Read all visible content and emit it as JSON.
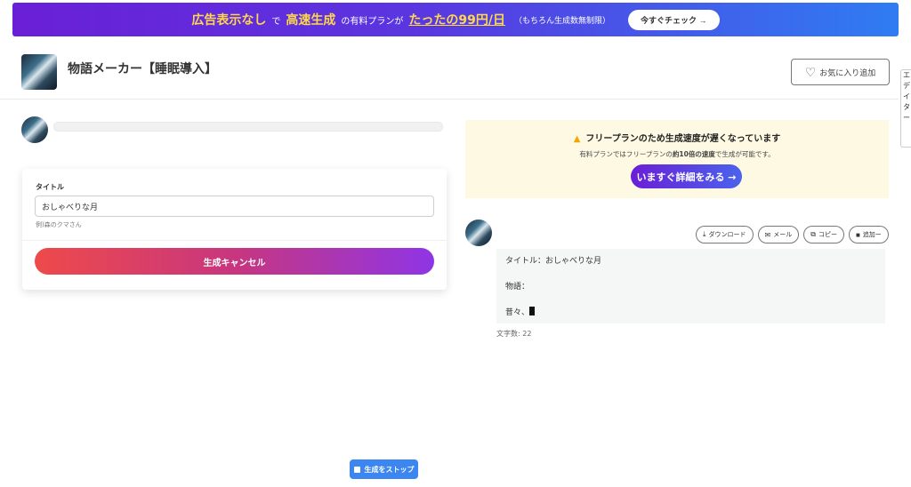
{
  "promo": {
    "part1": "広告表示なし",
    "part2": "で",
    "part3": "高速生成",
    "part4": "の有料プランが",
    "part5": "たったの99円/日",
    "note": "（もちろん生成数無制限）",
    "cta": "今すぐチェック →"
  },
  "header": {
    "title": "物語メーカー【睡眠導入】",
    "favorite_label": "お気に入り追加",
    "favorite_icon": "heart-icon"
  },
  "edge_widget": {
    "chars": [
      "エ",
      "デ",
      "イ",
      "タ",
      "ー"
    ]
  },
  "form": {
    "title_label": "タイトル",
    "title_value": "おしゃべりな月",
    "title_hint": "例)森のクマさん",
    "cancel_label": "生成キャンセル"
  },
  "notice": {
    "icon": "warning-icon",
    "heading": "フリープランのため生成速度が遅くなっています",
    "sub_pre": "有料プランではフリープランの",
    "sub_bold": "約10倍の速度",
    "sub_post": "で生成が可能です。",
    "button": "いますぐ詳細をみる →"
  },
  "result": {
    "actions": [
      {
        "icon": "download-icon",
        "label": "ダウンロード"
      },
      {
        "icon": "mail-icon",
        "label": "メール"
      },
      {
        "icon": "copy-icon",
        "label": "コピー"
      },
      {
        "icon": "save-icon",
        "label": "追加ー"
      }
    ],
    "lines": [
      "タイトル：おしゃべりな月",
      "物語：",
      "昔々、"
    ],
    "char_count": "文字数: 22"
  },
  "stop_button": "生成をストップ",
  "colors": {
    "brand_purple": "#6a1fd6",
    "brand_blue": "#2f7cf2",
    "highlight_yellow": "#ffd84a",
    "notice_bg": "#fdf9e3",
    "stop_blue": "#3b86f0"
  }
}
